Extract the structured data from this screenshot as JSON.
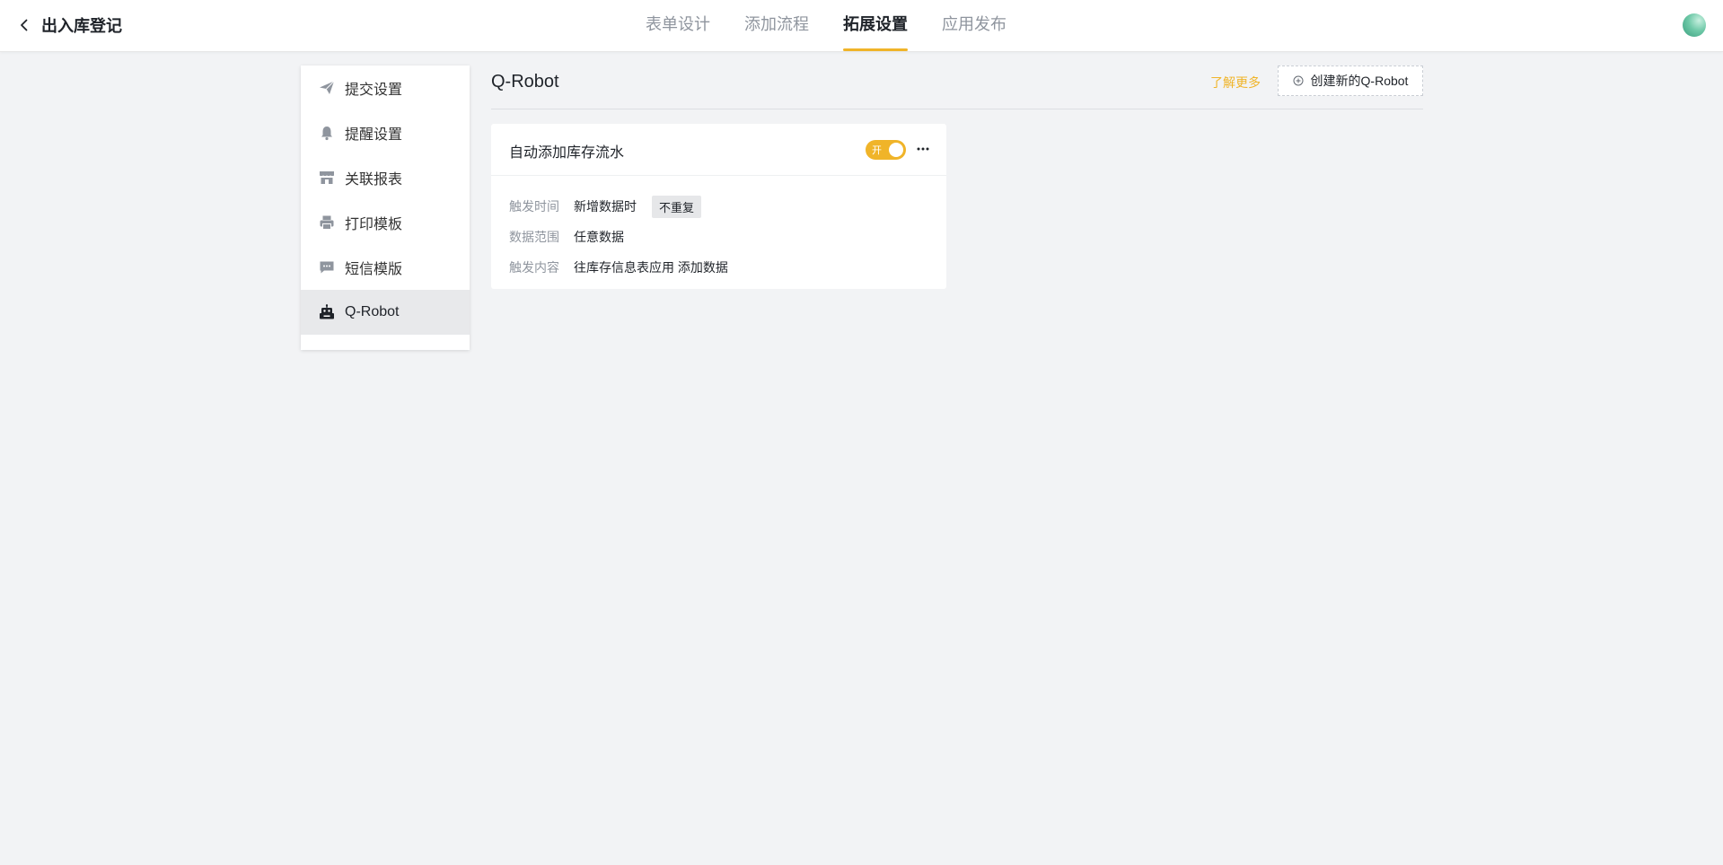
{
  "header": {
    "back_title": "出入库登记",
    "tabs": [
      {
        "label": "表单设计",
        "active": false
      },
      {
        "label": "添加流程",
        "active": false
      },
      {
        "label": "拓展设置",
        "active": true
      },
      {
        "label": "应用发布",
        "active": false
      }
    ],
    "accent_color": "#f0b429"
  },
  "sidebar": {
    "items": [
      {
        "label": "提交设置",
        "icon": "paper-plane-icon"
      },
      {
        "label": "提醒设置",
        "icon": "bell-icon"
      },
      {
        "label": "关联报表",
        "icon": "store-icon"
      },
      {
        "label": "打印模板",
        "icon": "printer-icon"
      },
      {
        "label": "短信模版",
        "icon": "message-icon"
      },
      {
        "label": "Q-Robot",
        "icon": "robot-icon",
        "active": true
      }
    ]
  },
  "main": {
    "title": "Q-Robot",
    "learn_more": "了解更多",
    "create_button": "创建新的Q-Robot",
    "card": {
      "title": "自动添加库存流水",
      "toggle_label": "开",
      "toggle_on": true,
      "rows": [
        {
          "key": "触发时间",
          "value": "新增数据时",
          "tag": "不重复"
        },
        {
          "key": "数据范围",
          "value": "任意数据"
        },
        {
          "key": "触发内容",
          "value": "往库存信息表应用 添加数据"
        }
      ]
    }
  }
}
